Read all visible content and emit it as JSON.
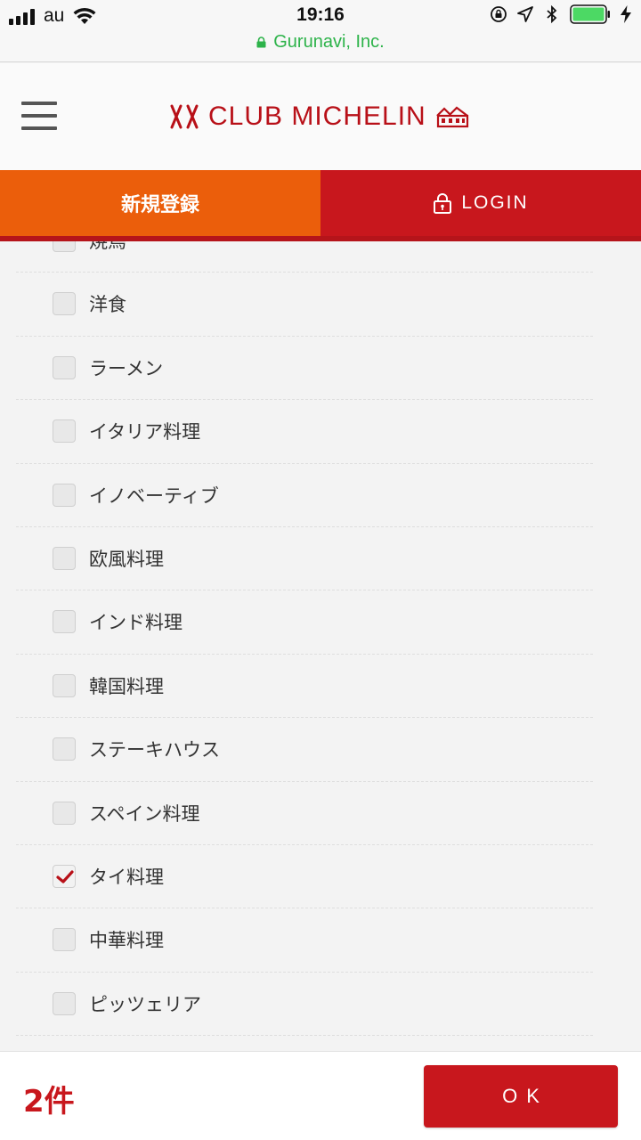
{
  "status_bar": {
    "carrier": "au",
    "time": "19:16",
    "url": "Gurunavi, Inc."
  },
  "header": {
    "logo_text": "CLUB MICHELIN",
    "brand_color": "#b81018"
  },
  "auth": {
    "register_label": "新規登録",
    "login_label": "LOGIN",
    "register_color": "#eb5e0b",
    "login_color": "#c8171d"
  },
  "cuisines": [
    {
      "label": "焼鳥",
      "checked": false
    },
    {
      "label": "洋食",
      "checked": false
    },
    {
      "label": "ラーメン",
      "checked": false
    },
    {
      "label": "イタリア料理",
      "checked": false
    },
    {
      "label": "イノベーティブ",
      "checked": false
    },
    {
      "label": "欧風料理",
      "checked": false
    },
    {
      "label": "インド料理",
      "checked": false
    },
    {
      "label": "韓国料理",
      "checked": false
    },
    {
      "label": "ステーキハウス",
      "checked": false
    },
    {
      "label": "スペイン料理",
      "checked": false
    },
    {
      "label": "タイ料理",
      "checked": true
    },
    {
      "label": "中華料理",
      "checked": false
    },
    {
      "label": "ピッツェリア",
      "checked": false
    }
  ],
  "footer": {
    "count_label": "2件",
    "ok_label": "OK"
  }
}
